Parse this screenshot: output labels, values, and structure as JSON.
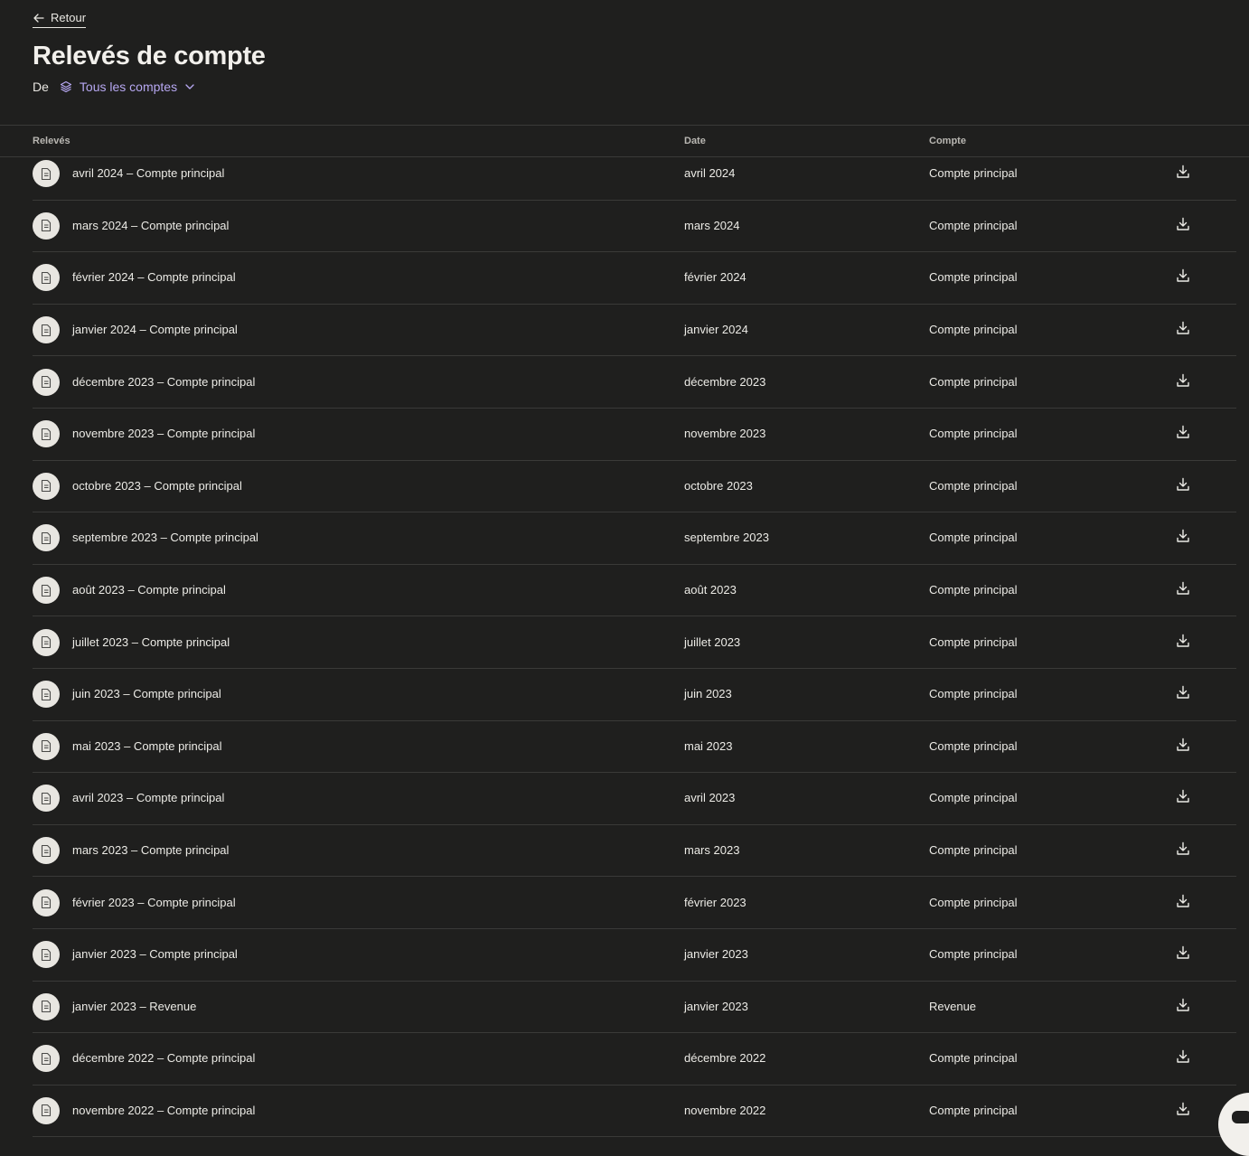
{
  "header": {
    "back_label": "Retour",
    "title": "Relevés de compte",
    "from_label": "De",
    "account_filter": "Tous les comptes"
  },
  "table": {
    "columns": [
      "Relevés",
      "Date",
      "Compte"
    ],
    "rows": [
      {
        "name": "avril 2024 – Compte principal",
        "date": "avril 2024",
        "account": "Compte principal"
      },
      {
        "name": "mars 2024 – Compte principal",
        "date": "mars 2024",
        "account": "Compte principal"
      },
      {
        "name": "février 2024 – Compte principal",
        "date": "février 2024",
        "account": "Compte principal"
      },
      {
        "name": "janvier 2024 – Compte principal",
        "date": "janvier 2024",
        "account": "Compte principal"
      },
      {
        "name": "décembre 2023 – Compte principal",
        "date": "décembre 2023",
        "account": "Compte principal"
      },
      {
        "name": "novembre 2023 – Compte principal",
        "date": "novembre 2023",
        "account": "Compte principal"
      },
      {
        "name": "octobre 2023 – Compte principal",
        "date": "octobre 2023",
        "account": "Compte principal"
      },
      {
        "name": "septembre 2023 – Compte principal",
        "date": "septembre 2023",
        "account": "Compte principal"
      },
      {
        "name": "août 2023 – Compte principal",
        "date": "août 2023",
        "account": "Compte principal"
      },
      {
        "name": "juillet 2023 – Compte principal",
        "date": "juillet 2023",
        "account": "Compte principal"
      },
      {
        "name": "juin 2023 – Compte principal",
        "date": "juin 2023",
        "account": "Compte principal"
      },
      {
        "name": "mai 2023 – Compte principal",
        "date": "mai 2023",
        "account": "Compte principal"
      },
      {
        "name": "avril 2023 – Compte principal",
        "date": "avril 2023",
        "account": "Compte principal"
      },
      {
        "name": "mars 2023 – Compte principal",
        "date": "mars 2023",
        "account": "Compte principal"
      },
      {
        "name": "février 2023 – Compte principal",
        "date": "février 2023",
        "account": "Compte principal"
      },
      {
        "name": "janvier 2023 – Compte principal",
        "date": "janvier 2023",
        "account": "Compte principal"
      },
      {
        "name": "janvier 2023 – Revenue",
        "date": "janvier 2023",
        "account": "Revenue"
      },
      {
        "name": "décembre 2022 – Compte principal",
        "date": "décembre 2022",
        "account": "Compte principal"
      },
      {
        "name": "novembre 2022 – Compte principal",
        "date": "novembre 2022",
        "account": "Compte principal"
      }
    ]
  },
  "icons": {
    "back": "arrow-left-icon",
    "account_filter": "layers-icon",
    "dropdown": "chevron-down-icon",
    "row": "document-icon",
    "action": "download-icon",
    "help": "chat-icon"
  },
  "colors": {
    "background": "#1f1f1e",
    "text": "#e9e7e2",
    "accent": "#b7a8f2",
    "divider": "#3a3a38"
  }
}
